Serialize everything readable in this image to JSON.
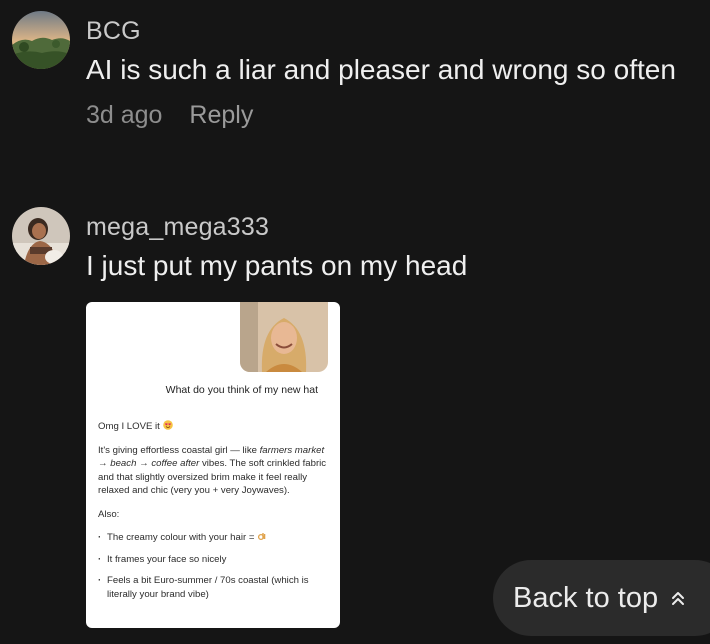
{
  "comments": [
    {
      "username": "BCG",
      "text": "AI is such a liar and pleaser and wrong so often",
      "time": "3d ago",
      "reply_label": "Reply",
      "avatar_icon": "landscape-avatar"
    },
    {
      "username": "mega_mega333",
      "text": "I just put my pants on my head",
      "avatar_icon": "person-avatar",
      "attachment": {
        "question": "What do you think of my new hat",
        "reply_intro": "Omg I LOVE it",
        "paragraph_1": "It's giving effortless coastal girl — like",
        "paragraph_1_em": "farmers market → beach → coffee after",
        "paragraph_1_rest": "vibes. The soft crinkled fabric and that slightly oversized brim make it feel really relaxed and chic (very you + very Joywaves).",
        "also_label": "Also:",
        "bullets": [
          "The creamy colour with your hair =",
          "It frames your face so nicely",
          "Feels a bit Euro-summer / 70s coastal (which is literally your brand vibe)"
        ]
      }
    }
  ],
  "back_to_top": {
    "label": "Back to top",
    "icon": "double-chevron-up-icon"
  },
  "colors": {
    "background": "#151515",
    "pill": "#2b2b2b",
    "muted_text": "#8d8d8d"
  }
}
